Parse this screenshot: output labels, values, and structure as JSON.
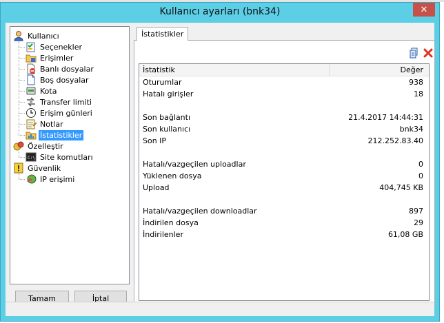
{
  "window": {
    "title": "Kullanıcı ayarları (bnk34)",
    "close_glyph": "✕"
  },
  "tree": [
    {
      "label": "Kullanıcı",
      "icon": "user-icon",
      "level": 0
    },
    {
      "label": "Seçenekler",
      "icon": "options-checklist-icon",
      "level": 1
    },
    {
      "label": "Erişimler",
      "icon": "folder-access-icon",
      "level": 1
    },
    {
      "label": "Banlı dosyalar",
      "icon": "banned-file-icon",
      "level": 1
    },
    {
      "label": "Boş dosyalar",
      "icon": "empty-file-icon",
      "level": 1
    },
    {
      "label": "Kota",
      "icon": "quota-icon",
      "level": 1
    },
    {
      "label": "Transfer limiti",
      "icon": "transfer-limit-icon",
      "level": 1
    },
    {
      "label": "Erişim günleri",
      "icon": "clock-icon",
      "level": 1
    },
    {
      "label": "Notlar",
      "icon": "notes-icon",
      "level": 1
    },
    {
      "label": "İstatistikler",
      "icon": "statistics-icon",
      "level": 1,
      "selected": true
    },
    {
      "label": "Özelleştir",
      "icon": "customize-icon",
      "level": 0
    },
    {
      "label": "Site komutları",
      "icon": "console-icon",
      "level": 1
    },
    {
      "label": "Güvenlik",
      "icon": "security-icon",
      "level": 0
    },
    {
      "label": "IP erişimi",
      "icon": "ip-access-icon",
      "level": 1
    }
  ],
  "buttons": {
    "ok": "Tamam",
    "cancel": "İptal"
  },
  "tab": {
    "label": "İstatistikler"
  },
  "toolbar": {
    "copy_icon": "copy-icon",
    "clear_icon": "delete-x-icon",
    "accent_red": "#e0301e"
  },
  "stats": {
    "header": {
      "name": "İstatistik",
      "value": "Değer"
    },
    "groups": [
      [
        {
          "name": "Oturumlar",
          "value": "938"
        },
        {
          "name": "Hatalı girişler",
          "value": "18"
        }
      ],
      [
        {
          "name": "Son bağlantı",
          "value": "21.4.2017 14:44:31"
        },
        {
          "name": "Son kullanıcı",
          "value": "bnk34"
        },
        {
          "name": "Son IP",
          "value": "212.252.83.40"
        }
      ],
      [
        {
          "name": "Hatalı/vazgeçilen uploadlar",
          "value": "0"
        },
        {
          "name": "Yüklenen dosya",
          "value": "0"
        },
        {
          "name": "Upload",
          "value": "404,745 KB"
        }
      ],
      [
        {
          "name": "Hatalı/vazgeçilen downloadlar",
          "value": "897"
        },
        {
          "name": "İndirilen dosya",
          "value": "29"
        },
        {
          "name": "İndirilenler",
          "value": "61,08 GB"
        }
      ]
    ]
  },
  "colors": {
    "titlebar": "#5ccfe6",
    "selection": "#3399ff",
    "close": "#c7504a"
  }
}
